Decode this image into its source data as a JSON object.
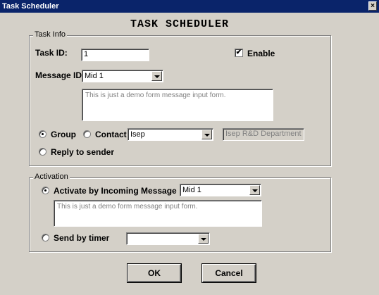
{
  "window": {
    "title": "Task Scheduler",
    "close_glyph": "×"
  },
  "heading": "TASK SCHEDULER",
  "task_info": {
    "legend": "Task Info",
    "task_id_label": "Task ID:",
    "task_id_value": "1",
    "enable_label": "Enable",
    "enable_checked": true,
    "message_id_label": "Message ID",
    "message_id_value": "Mid 1",
    "message_text": "This is just a demo form message input form.",
    "group_label": "Group",
    "contact_label": "Contact",
    "contact_value": "Isep",
    "department_value": "Isep R&D Department",
    "reply_label": "Reply to sender",
    "selected_option": "Group"
  },
  "activation": {
    "legend": "Activation",
    "incoming_label": "Activate by Incoming Message",
    "incoming_value": "Mid 1",
    "incoming_text": "This is just a demo form message input form.",
    "timer_label": "Send by timer",
    "timer_value": "",
    "selected_option": "Activate by Incoming Message"
  },
  "buttons": {
    "ok": "OK",
    "cancel": "Cancel"
  }
}
